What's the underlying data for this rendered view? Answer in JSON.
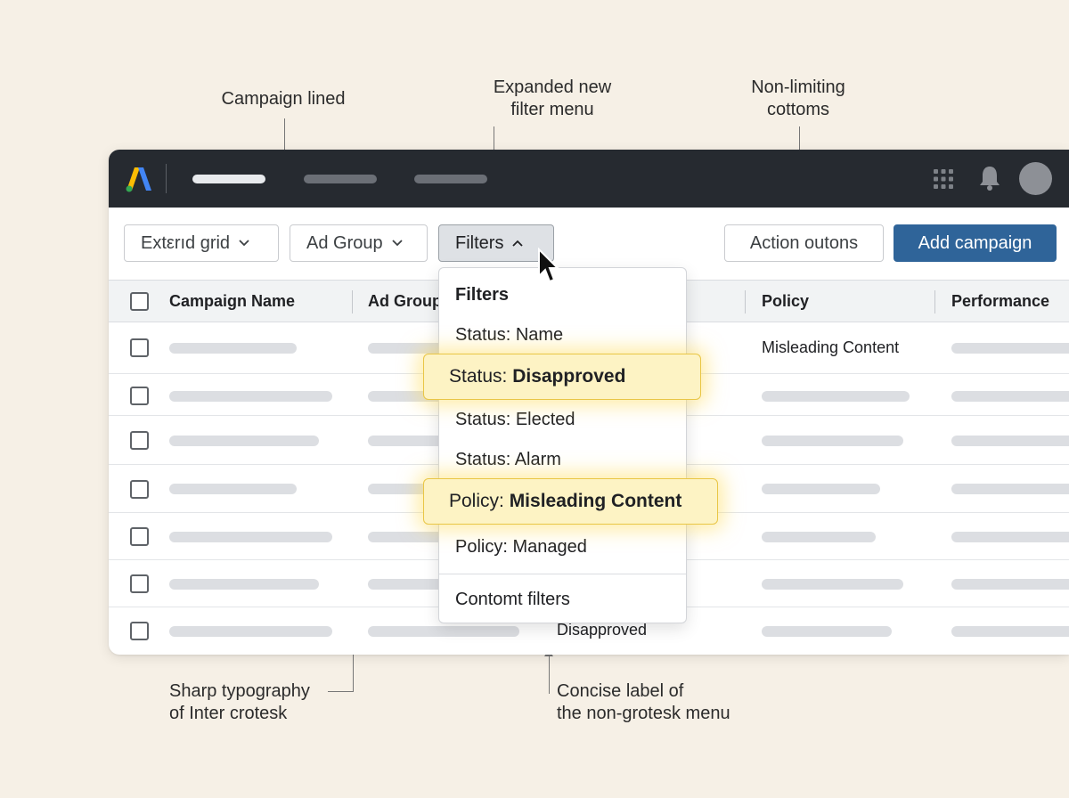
{
  "annotations": {
    "campaign_lined": "Campaign lined",
    "expanded_menu_line1": "Expanded new",
    "expanded_menu_line2": "filter menu",
    "non_limiting_line1": "Non-limiting",
    "non_limiting_line2": "cottoms",
    "sharp_typo_line1": "Sharp typography",
    "sharp_typo_line2": "of Inter crotesk",
    "concise_line1": "Concise label of",
    "concise_line2": "the non-grotesk menu"
  },
  "topbar": {
    "logo": "ads-logo-icon",
    "icons": [
      "apps-grid-icon",
      "bell-icon",
      "avatar"
    ]
  },
  "toolbar": {
    "extend_grid": "Extεrıd grid",
    "ad_group": "Ad Group",
    "filters": "Filters",
    "action_options": "Action outons",
    "add_campaign": "Add campaign"
  },
  "table": {
    "columns": [
      "Campaign Name",
      "Ad Group",
      "Policy",
      "Performance"
    ],
    "row1_policy": "Misleading Content",
    "row7_status": "Disapproved"
  },
  "filter_menu": {
    "title": "Filters",
    "items": {
      "status_name": "Status: Name",
      "status_disapproved_prefix": "Status: ",
      "status_disapproved_value": "Disapproved",
      "status_elected": "Status: Elected",
      "status_alarm": "Status: Alarm",
      "policy_misleading_prefix": "Policy: ",
      "policy_misleading_value": "Misleading Content",
      "policy_managed": "Policy: Managed",
      "custom_filters": "Contomt filters"
    }
  },
  "colors": {
    "accent": "#2f6499",
    "topbar": "#262a30",
    "highlight": "#fdf3c4",
    "background": "#f6f0e6"
  }
}
